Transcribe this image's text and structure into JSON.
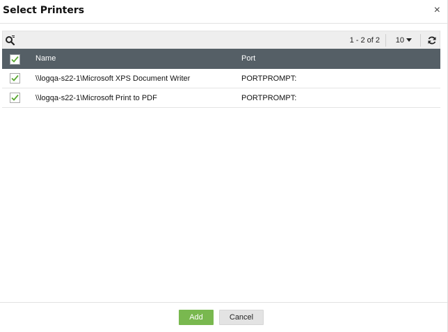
{
  "dialog": {
    "title": "Select Printers",
    "close_symbol": "×"
  },
  "toolbar": {
    "search_icon": "search-filter-icon",
    "paging_text": "1 - 2 of 2",
    "page_size": "10",
    "refresh_icon": "refresh-icon"
  },
  "table": {
    "header_checked": true,
    "columns": [
      "Name",
      "Port"
    ],
    "rows": [
      {
        "checked": true,
        "name": "\\\\logqa-s22-1\\Microsoft XPS Document Writer",
        "port": "PORTPROMPT:"
      },
      {
        "checked": true,
        "name": "\\\\logqa-s22-1\\Microsoft Print to PDF",
        "port": "PORTPROMPT:"
      }
    ]
  },
  "footer": {
    "add_label": "Add",
    "cancel_label": "Cancel"
  },
  "colors": {
    "header_bg": "#555f66",
    "add_button": "#79b84f",
    "check": "#5aa832"
  }
}
